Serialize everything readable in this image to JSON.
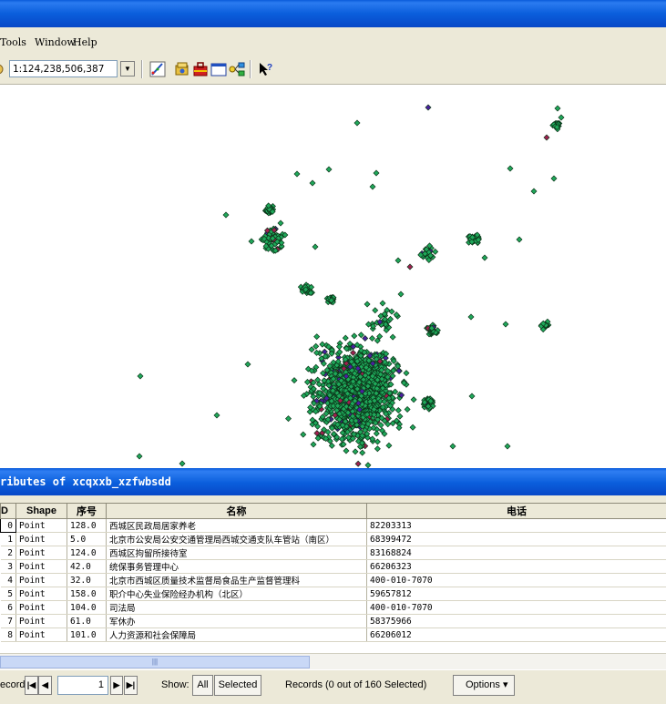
{
  "menu": {
    "tools": "Tools",
    "window": "Window",
    "help": "Help"
  },
  "toolbar": {
    "scale": "1:124,238,506,387",
    "dropdown_arrow": "▼",
    "icons": [
      "editor-icon",
      "catalog-icon",
      "toolbox-icon",
      "command-line-icon",
      "model-builder-icon",
      "whats-this-icon"
    ]
  },
  "attribute_pane": {
    "title": "ributes of xcqxxb_xzfwbsdd",
    "columns": [
      "D",
      "Shape",
      "序号",
      "名称",
      "电话"
    ],
    "rows": [
      {
        "fid": "0",
        "shape": "Point",
        "seq": "128.0",
        "name": "西城区民政局居家养老",
        "phone": "82203313"
      },
      {
        "fid": "1",
        "shape": "Point",
        "seq": "5.0",
        "name": "北京市公安局公安交通管理局西城交通支队车管站（南区）",
        "phone": "68399472"
      },
      {
        "fid": "2",
        "shape": "Point",
        "seq": "124.0",
        "name": "西城区拘留所接待室",
        "phone": "83168824"
      },
      {
        "fid": "3",
        "shape": "Point",
        "seq": "42.0",
        "name": "统保事务管理中心",
        "phone": "66206323"
      },
      {
        "fid": "4",
        "shape": "Point",
        "seq": "32.0",
        "name": "北京市西城区质量技术监督局食品生产监督管理科",
        "phone": "400-010-7070"
      },
      {
        "fid": "5",
        "shape": "Point",
        "seq": "158.0",
        "name": "职介中心失业保险经办机构（北区）",
        "phone": "59657812"
      },
      {
        "fid": "6",
        "shape": "Point",
        "seq": "104.0",
        "name": "司法局",
        "phone": "400-010-7070"
      },
      {
        "fid": "7",
        "shape": "Point",
        "seq": "61.0",
        "name": "军休办",
        "phone": "58375966"
      },
      {
        "fid": "8",
        "shape": "Point",
        "seq": "101.0",
        "name": "人力资源和社会保障局",
        "phone": "66206012"
      }
    ]
  },
  "navigation": {
    "record_label": "ecord:",
    "first": "|◀",
    "prev": "◀",
    "current_record": "1",
    "next": "▶",
    "last": "▶|",
    "show_label": "Show:",
    "all_label": "All",
    "selected_label": "Selected",
    "records_status": "Records (0 out of 160 Selected)",
    "options_label": "Options",
    "options_arrow": "▾"
  },
  "colors": {
    "title_blue": "#0A5EDC",
    "point_green": "#1FA85A",
    "point_purple": "#4B1FA0",
    "point_magenta": "#A01F50"
  }
}
